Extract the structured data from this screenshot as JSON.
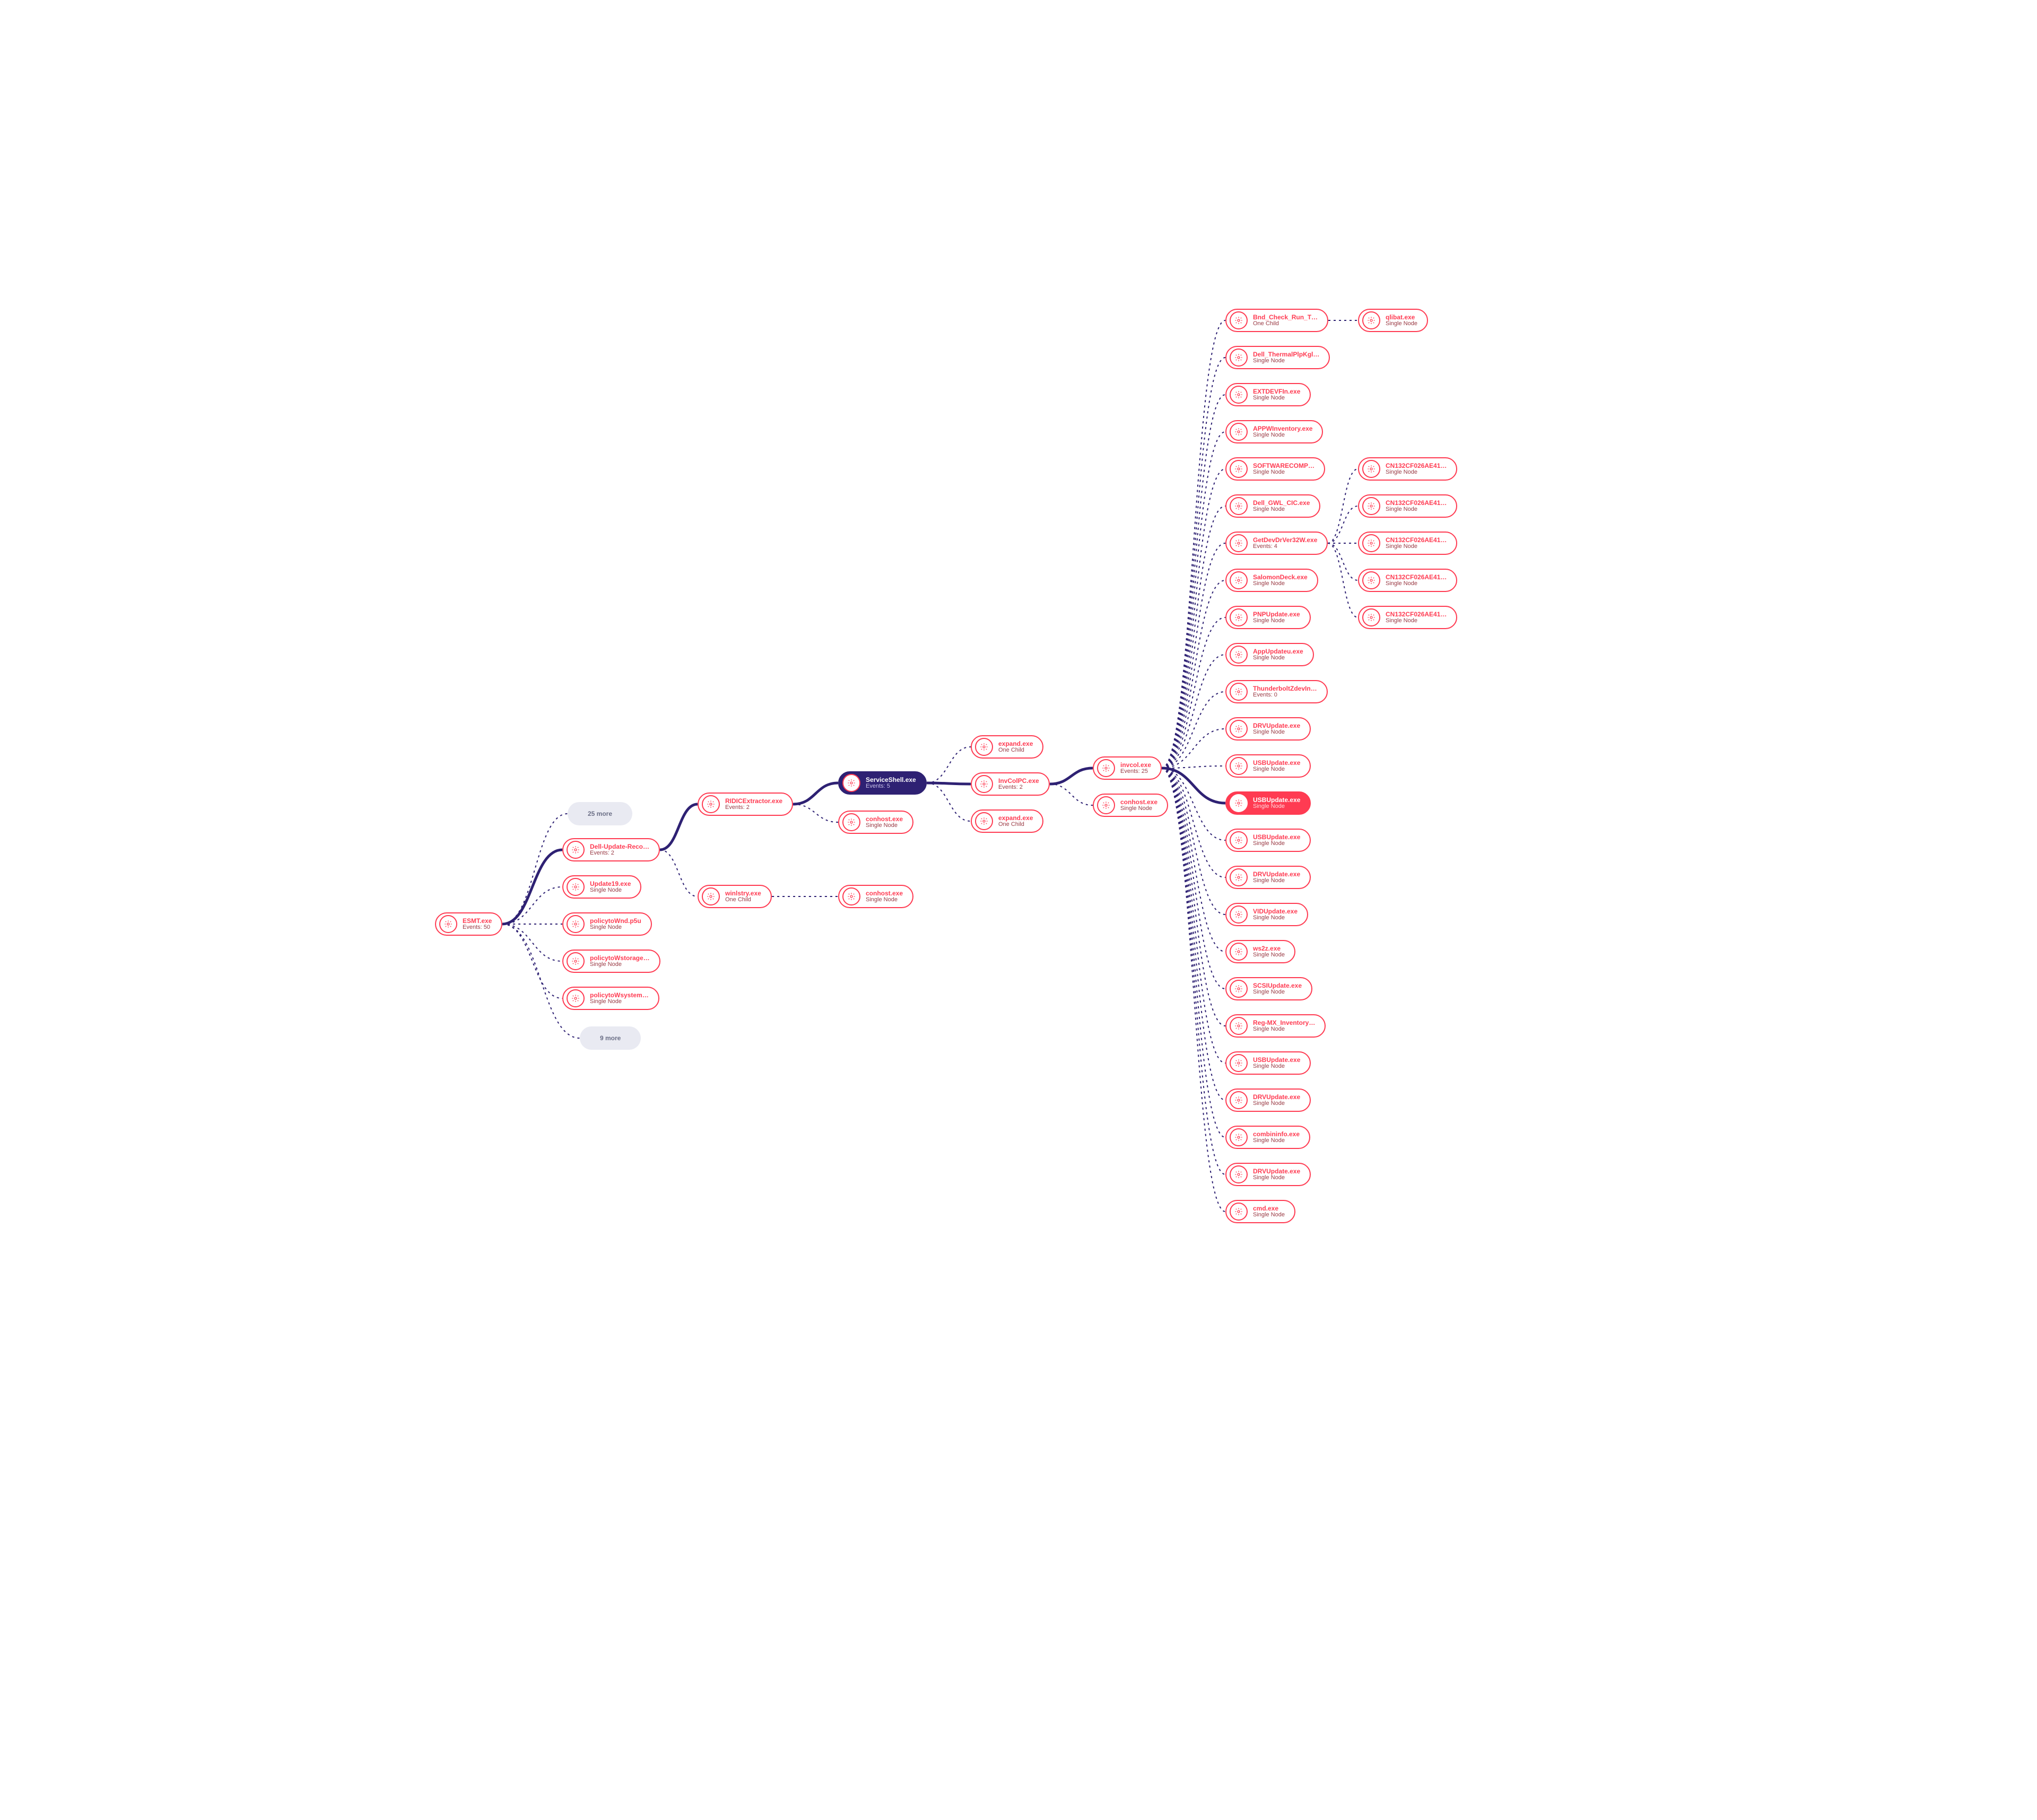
{
  "root": {
    "title": "ESMT.exe",
    "sub": "Events: 50"
  },
  "pill_more": "25 more",
  "pill_less": "9 more",
  "left": [
    {
      "title": "Dell-Update-Reco…",
      "sub": "Events: 2"
    },
    {
      "title": "Update19.exe",
      "sub": "Single Node"
    },
    {
      "title": "policytoWnd.p5u",
      "sub": "Single Node"
    },
    {
      "title": "policytoWstorage…",
      "sub": "Single Node"
    },
    {
      "title": "policytoWsystem…",
      "sub": "Single Node"
    }
  ],
  "dell": [
    {
      "title": "RIDICExtractor.exe",
      "sub": "Events: 2"
    },
    {
      "title": "winlstry.exe",
      "sub": "One Child"
    }
  ],
  "ridic": [
    {
      "title": "conhost.exe",
      "sub": "Single Node"
    },
    {
      "title": "conhost.exe",
      "sub": "Single Node"
    }
  ],
  "center": {
    "title": "ServiceShell.exe",
    "sub": "Events: 5"
  },
  "svc": [
    {
      "title": "expand.exe",
      "sub": "One Child"
    },
    {
      "title": "InvColPC.exe",
      "sub": "Events: 2"
    },
    {
      "title": "expand.exe",
      "sub": "One Child"
    }
  ],
  "inv": [
    {
      "title": "invcol.exe",
      "sub": "Events: 25"
    },
    {
      "title": "conhost.exe",
      "sub": "Single Node"
    }
  ],
  "big": [
    {
      "title": "Bnd_Check_Run_T…",
      "sub": "One Child"
    },
    {
      "title": "Dell_ThermalPlpKgl…",
      "sub": "Single Node"
    },
    {
      "title": "EXTDEVFIn.exe",
      "sub": "Single Node"
    },
    {
      "title": "APPWInventory.exe",
      "sub": "Single Node"
    },
    {
      "title": "SOFTWARECOMP…",
      "sub": "Single Node"
    },
    {
      "title": "Dell_GWL_CIC.exe",
      "sub": "Single Node"
    },
    {
      "title": "GetDevDrVer32W.exe",
      "sub": "Events: 4"
    },
    {
      "title": "SalomonDeck.exe",
      "sub": "Single Node"
    },
    {
      "title": "PNPUpdate.exe",
      "sub": "Single Node"
    },
    {
      "title": "AppUpdateu.exe",
      "sub": "Single Node"
    },
    {
      "title": "ThunderboltZdevIn…",
      "sub": "Events: 0"
    },
    {
      "title": "DRVUpdate.exe",
      "sub": "Single Node"
    },
    {
      "title": "USBUpdate.exe",
      "sub": "Single Node"
    },
    {
      "title": "USBUpdate.exe",
      "sub": "Single Node",
      "hl": true
    },
    {
      "title": "USBUpdate.exe",
      "sub": "Single Node"
    },
    {
      "title": "DRVUpdate.exe",
      "sub": "Single Node"
    },
    {
      "title": "VIDUpdate.exe",
      "sub": "Single Node"
    },
    {
      "title": "ws2z.exe",
      "sub": "Single Node"
    },
    {
      "title": "SCSIUpdate.exe",
      "sub": "Single Node"
    },
    {
      "title": "Reg-MX_Inventory…",
      "sub": "Single Node"
    },
    {
      "title": "USBUpdate.exe",
      "sub": "Single Node"
    },
    {
      "title": "DRVUpdate.exe",
      "sub": "Single Node"
    },
    {
      "title": "combininfo.exe",
      "sub": "Single Node"
    },
    {
      "title": "DRVUpdate.exe",
      "sub": "Single Node"
    },
    {
      "title": "cmd.exe",
      "sub": "Single Node"
    }
  ],
  "bnd": {
    "title": "qlibat.exe",
    "sub": "Single Node"
  },
  "gdv": [
    {
      "title": "CN132CF026AE41…",
      "sub": "Single Node"
    },
    {
      "title": "CN132CF026AE41…",
      "sub": "Single Node"
    },
    {
      "title": "CN132CF026AE41…",
      "sub": "Single Node"
    },
    {
      "title": "CN132CF026AE41…",
      "sub": "Single Node"
    },
    {
      "title": "CN132CF026AE41…",
      "sub": "Single Node"
    }
  ]
}
